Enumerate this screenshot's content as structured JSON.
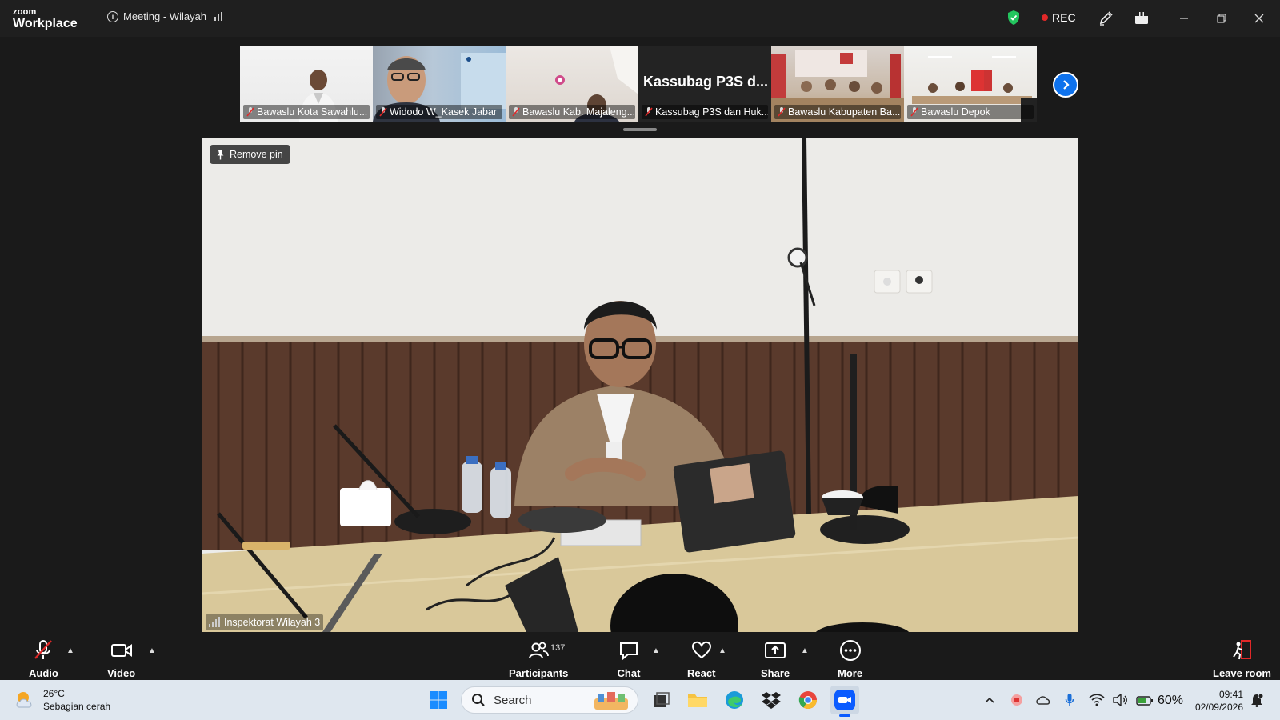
{
  "titlebar": {
    "logo_small": "zoom",
    "logo_big": "Workplace",
    "meeting_title": "Meeting - Wilayah",
    "rec_label": "REC"
  },
  "thumbnails": [
    {
      "label": "Bawaslu Kota Sawahlu..."
    },
    {
      "label": "Widodo W_Kasek Jabar"
    },
    {
      "label": "Bawaslu Kab. Majaleng..."
    },
    {
      "label": "Kassubag P3S dan Huk...",
      "name_big": "Kassubag P3S d..."
    },
    {
      "label": "Bawaslu Kabupaten Ba..."
    },
    {
      "label": "Bawaslu Depok"
    }
  ],
  "main_video": {
    "pin_label": "Remove pin",
    "speaker_name": "Inspektorat Wilayah 3"
  },
  "toolbar": {
    "audio": "Audio",
    "video": "Video",
    "participants": "Participants",
    "participant_count": "137",
    "chat": "Chat",
    "react": "React",
    "share": "Share",
    "more": "More",
    "leave": "Leave room"
  },
  "taskbar": {
    "temperature": "26°C",
    "weather_desc": "Sebagian cerah",
    "search_placeholder": "Search",
    "battery": "60%",
    "time": "09:41",
    "date": "02/09/2026"
  },
  "colors": {
    "accent": "#0e72ed",
    "rec": "#e02828",
    "shield": "#23c55e",
    "mic_muted": "#e02828"
  }
}
